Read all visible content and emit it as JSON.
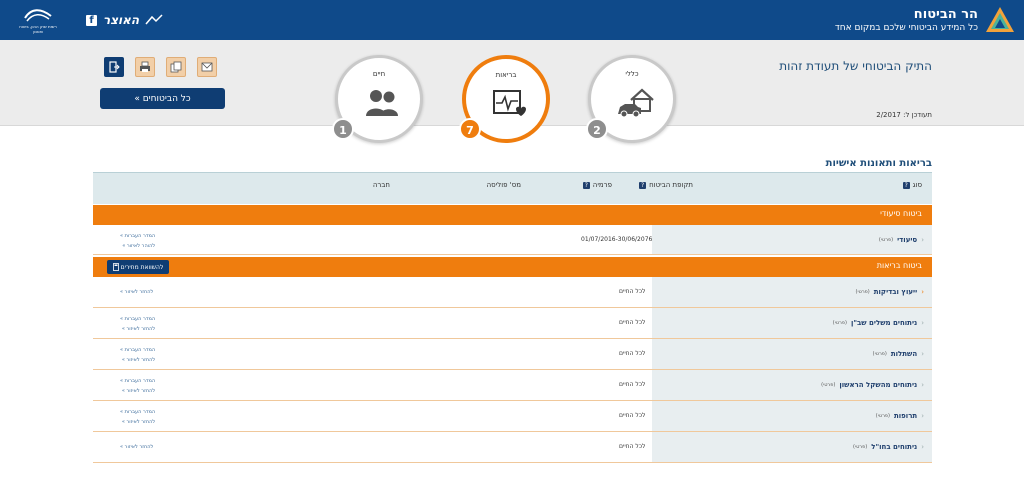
{
  "header": {
    "brand_title": "הר הביטוח",
    "brand_subtitle": "כל המידע הביטוחי שלכם במקום אחד",
    "otzar_name": "האוצר",
    "fb_label": "f",
    "govt_logo_text": "רשות שוק ההון, ביטוח וחסכון"
  },
  "page": {
    "title": "התיק הביטוחי של תעודת זהות",
    "updated": "תעודכן ל: 2/2017",
    "all_insurances_button": "כל הביטוחים »"
  },
  "categories": [
    {
      "title": "כללי",
      "count": "2",
      "icon": "house-car-icon",
      "active": false
    },
    {
      "title": "בריאות",
      "count": "7",
      "icon": "health-monitor-icon",
      "active": true
    },
    {
      "title": "חיים",
      "count": "1",
      "icon": "family-icon",
      "active": false
    }
  ],
  "toolbar": {
    "icons": [
      "exit-icon",
      "print-icon",
      "copy-icon",
      "mail-icon"
    ]
  },
  "section": {
    "title": "בריאות ותאונות אישיות",
    "columns": {
      "type": "סוג",
      "period": "תקופת הביטוח",
      "premium": "פרמיה",
      "policy_no": "מס' פוליסה",
      "company": "חברה"
    },
    "groups": [
      {
        "label": "ביטוח סיעודי",
        "compare_button": "",
        "rows": [
          {
            "name": "סיעודי",
            "tag": "(פרטי)",
            "period": "01/07/2016-30/06/2076",
            "forever": "",
            "links": [
              "המדר העברות »",
              "להוהר לאיזור »"
            ],
            "active": false
          }
        ]
      },
      {
        "label": "ביטוח בריאות",
        "compare_button": "להשוואת מחירים",
        "rows": [
          {
            "name": "ייעוץ ובדיקות",
            "tag": "(פרטי)",
            "period": "",
            "forever": "לכל החיים",
            "links": [
              "להחזר לאיזור »"
            ],
            "active": true
          },
          {
            "name": "ניתוחים משלים שב\"ן",
            "tag": "(פרטי)",
            "period": "",
            "forever": "לכל החיים",
            "links": [
              "המדר העברות »",
              "להחזר לאיזור »"
            ],
            "active": false
          },
          {
            "name": "השתלות",
            "tag": "(פרטי)",
            "period": "",
            "forever": "לכל החיים",
            "links": [
              "המדר העברות »",
              "להחזר לאיזור »"
            ],
            "active": false
          },
          {
            "name": "ניתוחים מהשקל הראשון",
            "tag": "(פרטי)",
            "period": "",
            "forever": "לכל החיים",
            "links": [
              "המדר העברות »",
              "להחזר לאיזור »"
            ],
            "active": false
          },
          {
            "name": "תרופות",
            "tag": "(פרטי)",
            "period": "",
            "forever": "לכל החיים",
            "links": [
              "המדר העברות »",
              "להחזר לאיזור »"
            ],
            "active": false
          },
          {
            "name": "ניתוחים בחו\"ל",
            "tag": "(פרטי)",
            "period": "",
            "forever": "לכל החיים",
            "links": [
              "להחזר לאיזור »"
            ],
            "active": false
          }
        ]
      }
    ]
  },
  "colors": {
    "header_blue": "#0f4a8a",
    "accent_orange": "#ef7d0e",
    "navy": "#0f3d73",
    "band_grey": "#ececec"
  }
}
